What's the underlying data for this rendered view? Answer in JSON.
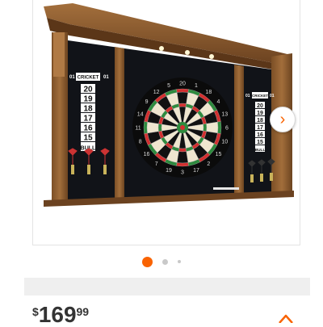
{
  "product": {
    "image_icon": "dartboard-cabinet-image",
    "left_scoreboard": {
      "title": "CRICKET",
      "left_num": "01",
      "right_num": "01",
      "rows": [
        "20",
        "19",
        "18",
        "17",
        "16",
        "15",
        "BULL"
      ]
    },
    "right_scoreboard": {
      "title": "CRICKET",
      "left_num": "01",
      "right_num": "01",
      "rows": [
        "20",
        "19",
        "18",
        "17",
        "16",
        "15",
        "BULL"
      ]
    },
    "board_numbers": [
      "20",
      "1",
      "18",
      "4",
      "13",
      "6",
      "10",
      "15",
      "2",
      "17",
      "3",
      "19",
      "7",
      "16",
      "8",
      "11",
      "14",
      "9",
      "12",
      "5"
    ]
  },
  "carousel": {
    "next_icon": "chevron-right-icon",
    "next_glyph": "›",
    "total_images": 3,
    "active_index": 1
  },
  "price": {
    "currency": "$",
    "dollars": "169",
    "cents": "99"
  },
  "share": {
    "icon": "share-icon"
  },
  "colors": {
    "accent": "#f96302",
    "wood": "#8a5a2b",
    "cabinet_dark": "#111318",
    "board_red": "#d32f2f",
    "board_green": "#2e8b3e"
  }
}
